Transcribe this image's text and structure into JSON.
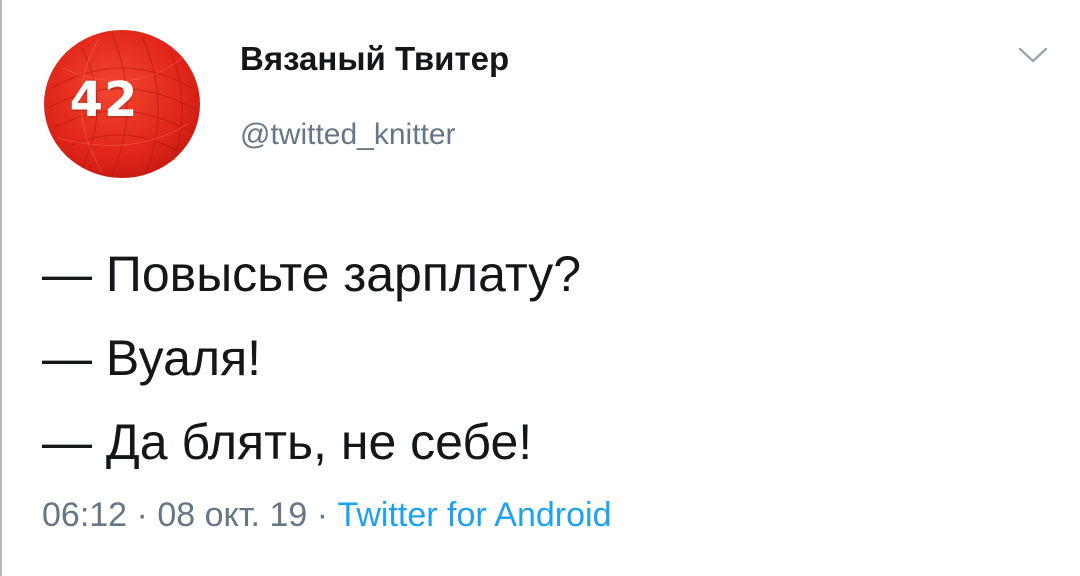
{
  "author": {
    "display_name": "Вязаный Твитер",
    "handle": "@twitted_knitter",
    "avatar_number": "42",
    "avatar_color": "#e0251a"
  },
  "tweet": {
    "lines": [
      "— Повысьте зарплату?",
      "— Вуаля!",
      "— Да блять, не себе!"
    ]
  },
  "meta": {
    "time": "06:12",
    "separator_1": " · ",
    "date": "08 окт. 19",
    "separator_2": " · ",
    "source": "Twitter for Android"
  },
  "icons": {
    "menu": "chevron-down-icon"
  },
  "colors": {
    "text": "#14171a",
    "muted": "#657786",
    "link": "#1da1f2"
  }
}
